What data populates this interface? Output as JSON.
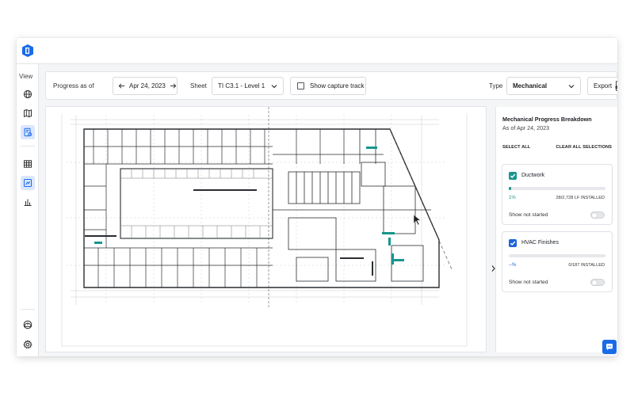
{
  "rail": {
    "view_label": "View",
    "items": [
      {
        "name": "globe-icon",
        "active": false
      },
      {
        "name": "map-icon",
        "active": false
      },
      {
        "name": "progress-report-icon",
        "active": true
      },
      {
        "name": "table-icon",
        "active": false
      },
      {
        "name": "floorplan-icon",
        "active": true
      },
      {
        "name": "bar-chart-icon",
        "active": false
      },
      {
        "name": "hardhat-icon",
        "active": false
      },
      {
        "name": "settings-gear-icon",
        "active": false
      }
    ]
  },
  "toolbar": {
    "progress_as_of_label": "Progress as of",
    "date": "Apr 24, 2023",
    "sheet_label": "Sheet",
    "sheet_value": "TI C3.1 - Level 1",
    "capture_track_label": "Show capture track",
    "capture_track_checked": false,
    "type_label": "Type",
    "type_value": "Mechanical",
    "export_label": "Export",
    "export_icon": "pdf-icon"
  },
  "panel": {
    "title": "Mechanical Progress Breakdown",
    "subtitle": "As of Apr 24, 2023",
    "select_all": "SELECT ALL",
    "clear_all": "CLEAR ALL SELECTIONS",
    "cards": [
      {
        "title": "Ductwork",
        "checked": true,
        "checkbox_color": "#17958e",
        "percent": "1%",
        "progress_fraction": 0.01,
        "progress_color": "#17958e",
        "installed": "28/2,728 LF INSTALLED",
        "not_started_label": "Show not started",
        "not_started_on": false
      },
      {
        "title": "HVAC Finishes",
        "checked": true,
        "checkbox_color": "#1d63e0",
        "percent": "--%",
        "progress_fraction": 0,
        "progress_color": "#1d63e0",
        "installed": "0/187 INSTALLED",
        "not_started_label": "Show not started",
        "not_started_on": false
      }
    ]
  },
  "colors": {
    "accent": "#1a6be8",
    "ductwork": "#17958e",
    "hvac": "#1d63e0",
    "plan_line": "#2a2d31"
  }
}
